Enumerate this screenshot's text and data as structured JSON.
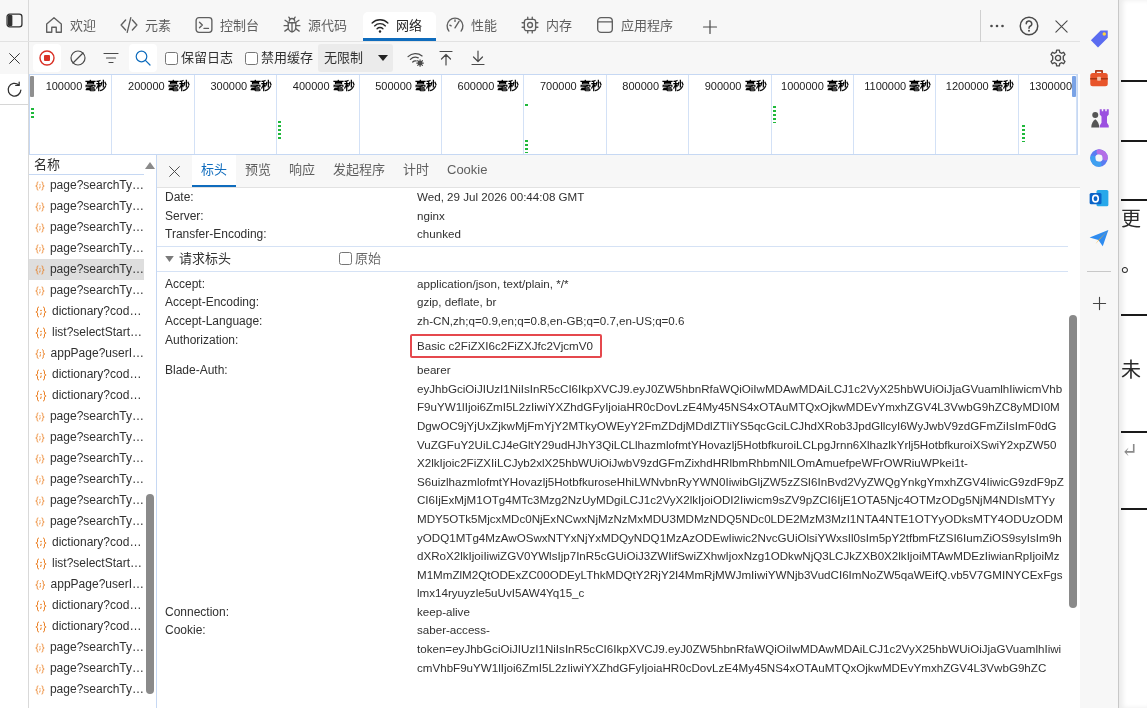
{
  "devtools": {
    "tabs": [
      {
        "label": "欢迎",
        "selected": false
      },
      {
        "label": "元素",
        "selected": false
      },
      {
        "label": "控制台",
        "selected": false
      },
      {
        "label": "源代码",
        "selected": false
      },
      {
        "label": "网络",
        "selected": true
      },
      {
        "label": "性能",
        "selected": false
      },
      {
        "label": "内存",
        "selected": false
      },
      {
        "label": "应用程序",
        "selected": false
      }
    ],
    "toolbar": {
      "recording": true,
      "search_active": true,
      "options": [
        {
          "label": "保留日志",
          "checked": false
        },
        {
          "label": "禁用缓存",
          "checked": false
        }
      ],
      "throttling": "无限制"
    },
    "overview": {
      "ticks": [
        "100000 **毫秒**",
        "200000 **毫秒**",
        "300000 **毫秒**",
        "400000 **毫秒**",
        "500000 **毫秒**",
        "600000 **毫秒**",
        "700000 **毫秒**",
        "800000 **毫秒**",
        "900000 **毫秒**",
        "1000000 **毫秒**",
        "1100000 **毫秒**",
        "1200000 **毫秒**",
        "1300000"
      ]
    },
    "requests": {
      "header": "名称",
      "items": [
        {
          "name": "page?searchTy…",
          "selected": false
        },
        {
          "name": "page?searchTy…",
          "selected": false
        },
        {
          "name": "page?searchTy…",
          "selected": false
        },
        {
          "name": "page?searchTy…",
          "selected": false
        },
        {
          "name": "page?searchTy…",
          "selected": true
        },
        {
          "name": "page?searchTy…",
          "selected": false
        },
        {
          "name": "dictionary?cod…",
          "selected": false
        },
        {
          "name": "list?selectStart…",
          "selected": false
        },
        {
          "name": "appPage?userI…",
          "selected": false
        },
        {
          "name": "dictionary?cod…",
          "selected": false
        },
        {
          "name": "dictionary?cod…",
          "selected": false
        },
        {
          "name": "page?searchTy…",
          "selected": false
        },
        {
          "name": "page?searchTy…",
          "selected": false
        },
        {
          "name": "page?searchTy…",
          "selected": false
        },
        {
          "name": "page?searchTy…",
          "selected": false
        },
        {
          "name": "page?searchTy…",
          "selected": false
        },
        {
          "name": "page?searchTy…",
          "selected": false
        },
        {
          "name": "dictionary?cod…",
          "selected": false
        },
        {
          "name": "list?selectStart…",
          "selected": false
        },
        {
          "name": "appPage?userI…",
          "selected": false
        },
        {
          "name": "dictionary?cod…",
          "selected": false
        },
        {
          "name": "dictionary?cod…",
          "selected": false
        },
        {
          "name": "page?searchTy…",
          "selected": false
        },
        {
          "name": "page?searchTy…",
          "selected": false
        },
        {
          "name": "page?searchTy…",
          "selected": false
        }
      ]
    },
    "detail": {
      "tabs": [
        {
          "label": "标头",
          "selected": true
        },
        {
          "label": "预览",
          "selected": false
        },
        {
          "label": "响应",
          "selected": false
        },
        {
          "label": "发起程序",
          "selected": false
        },
        {
          "label": "计时",
          "selected": false
        },
        {
          "label": "Cookie",
          "selected": false
        }
      ],
      "response_headers": [
        {
          "name": "Date:",
          "value": "Wed, 29 Jul 2026 00:44:08 GMT"
        },
        {
          "name": "Server:",
          "value": "nginx"
        },
        {
          "name": "Transfer-Encoding:",
          "value": "chunked"
        }
      ],
      "request_headers": {
        "title": "请求标头",
        "expanded": true,
        "raw": {
          "label": "原始",
          "checked": false
        },
        "rows": [
          {
            "name": "Accept:",
            "value": "application/json, text/plain, */*",
            "highlighted": false
          },
          {
            "name": "Accept-Encoding:",
            "value": "gzip, deflate, br",
            "highlighted": false
          },
          {
            "name": "Accept-Language:",
            "value": "zh-CN,zh;q=0.9,en;q=0.8,en-GB;q=0.7,en-US;q=0.6",
            "highlighted": false
          },
          {
            "name": "Authorization:",
            "value": "Basic c2FiZXI6c2FiZXJfc2VjcmV0",
            "highlighted": true
          },
          {
            "name": "Blade-Auth:",
            "value": "bearer eyJhbGciOiJIUzI1NiIsInR5cCI6IkpXVCJ9.eyJ0ZW5hbnRfaWQiOiIwMDAwMDAiLCJ1c2VyX25hbWUiOiJjaGVuamlhIiwicmVhbF9uYW1lIjoi6ZmI5L2zIiwiYXZhdGFyIjoiaHR0cDovLzE4My45NS4xOTAuMTQxOjkwMDEvYmxhZGV4L3VwbG9hZC8yMDI0MDgwOC9jYjUxZjkwMjFmYjY2MTkyOWEyY2FmZDdjMDdlZTliYS5qcGciLCJhdXRob3JpdGllcyI6WyJwbV9zdGFmZiIsImF0dGVuZGFuY2UiLCJ4eGltY29udHJhY3QiLCLlhazmlofmtYHovazlj5HotbfkuroiLCLpgJrnn6XlhazlkYrlj5HotbfkuroiXSwiY2xpZW50X2lkIjoic2FiZXIiLCJyb2xlX25hbWUiOiJwbV9zdGFmZixhdHRlbmRhbmNlLOmAmuefpeWFrOWRiuWPkei1t-S6uizlhazmlofmtYHovazlj5HotbfkuroseHhiLWNvbnRyYWN0IiwibGljZW5zZSI6InBvd2VyZWQgYnkgYmxhZGV4IiwicG9zdF9pZCI6IjExMjM1OTg4MTc3Mzg2NzUyMDgiLCJ1c2VyX2lkIjoiODI2Iiwicm9sZV9pZCI6IjE1OTA5Njc4OTMzODg5NjM4NDIsMTYyMDY5OTk5MjcxMDc0NjExNCwxNjMzNzMxMDU3MDMzNDQ5NDc0LDE2MzM3MzI1NTA4NTE1OTYyODksMTY4ODUzODMyODQ1MTg4MzAwOSwxNTYxNjYxMDQyNDQ1MzAzODEwIiwic2NvcGUiOlsiYWxsIl0sIm5pY2tfbmFtZSI6IumZiOS9syIsIm9hdXRoX2lkIjoiIiwiZGV0YWlsIjp7InR5cGUiOiJ3ZWIifSwiZXhwIjoxNzg1ODkwNjQ3LCJkZXB0X2lkIjoiMTAwMDEzIiwianRpIjoiMzM1MmZlM2QtODExZC00ODEyLThkMDQtY2RjY2I4MmRjMWJmIiwiYWNjb3VudCI6ImNoZW5qaWEifQ.vb5V7GMINYCExFgslmx14ryuyzle5uUvI5AW4Yq15_c",
            "highlighted": false
          },
          {
            "name": "Connection:",
            "value": "keep-alive",
            "highlighted": false
          },
          {
            "name": "Cookie:",
            "value": "saber-access-token=eyJhbGciOiJIUzI1NiIsInR5cCI6IkpXVCJ9.eyJ0ZW5hbnRfaWQiOiIwMDAwMDAiLCJ1c2VyX25hbWUiOiJjaGVuamlhIiwicmVhbF9uYW1lIjoi6ZmI5L2zIiwiYXZhdGFyIjoiaHR0cDovLzE4My45NS4xOTAuMTQxOjkwMDEvYmxhZGV4L3VwbG9hZC",
            "highlighted": false
          }
        ]
      }
    }
  },
  "background_page": {
    "cells": [
      {
        "lines": [
          "更",
          "。"
        ]
      },
      {
        "lines": [
          "未"
        ]
      },
      {
        "lines": [
          "↵"
        ]
      }
    ]
  }
}
